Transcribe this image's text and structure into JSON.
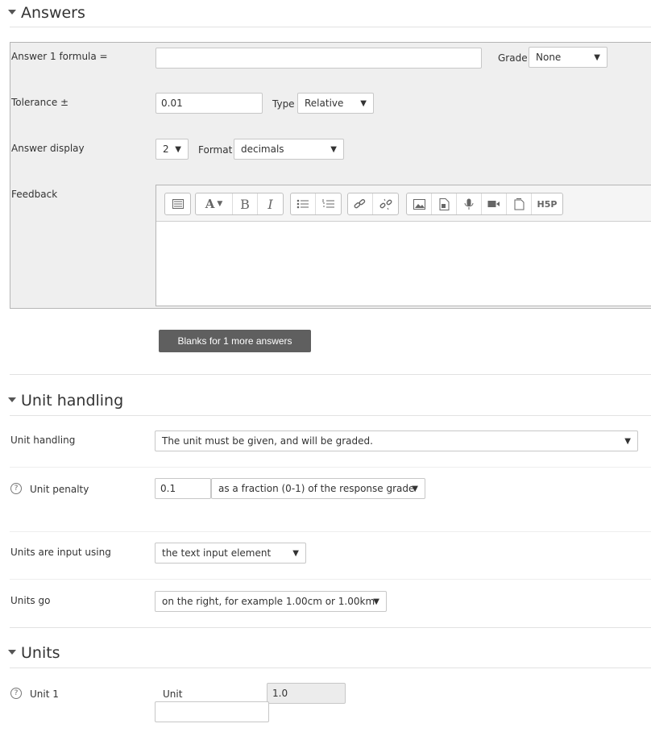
{
  "answers": {
    "title": "Answers",
    "answer1_label": "Answer 1 formula =",
    "answer1_value": "",
    "grade_label": "Grade",
    "grade_value": "None",
    "tolerance_label": "Tolerance ±",
    "tolerance_value": "0.01",
    "type_label": "Type",
    "type_value": "Relative",
    "display_label": "Answer display",
    "display_value": "2",
    "format_label": "Format",
    "format_value": "decimals",
    "feedback_label": "Feedback",
    "blanks_button": "Blanks for 1 more answers"
  },
  "unit_handling": {
    "title": "Unit handling",
    "handling_label": "Unit handling",
    "handling_value": "The unit must be given, and will be graded.",
    "penalty_label": "Unit penalty",
    "penalty_value": "0.1",
    "penalty_mode": "as a fraction (0-1) of the response grade",
    "input_label": "Units are input using",
    "input_value": "the text input element",
    "go_label": "Units go",
    "go_value": "on the right, for example 1.00cm or 1.00km"
  },
  "units": {
    "title": "Units",
    "unit1_label": "Unit 1",
    "unit_sub_label": "Unit",
    "unit_multiplier": "1.0",
    "unit_value": ""
  },
  "toolbar": {
    "icons": [
      "toolbar-toggle-icon",
      "font-style-icon",
      "bold-icon",
      "italic-icon",
      "unordered-list-icon",
      "ordered-list-icon",
      "link-icon",
      "unlink-icon",
      "image-icon",
      "media-icon",
      "record-audio-icon",
      "record-video-icon",
      "manage-files-icon",
      "h5p-icon"
    ],
    "bold_glyph": "B",
    "italic_glyph": "I",
    "h5p_text": "H5P"
  }
}
